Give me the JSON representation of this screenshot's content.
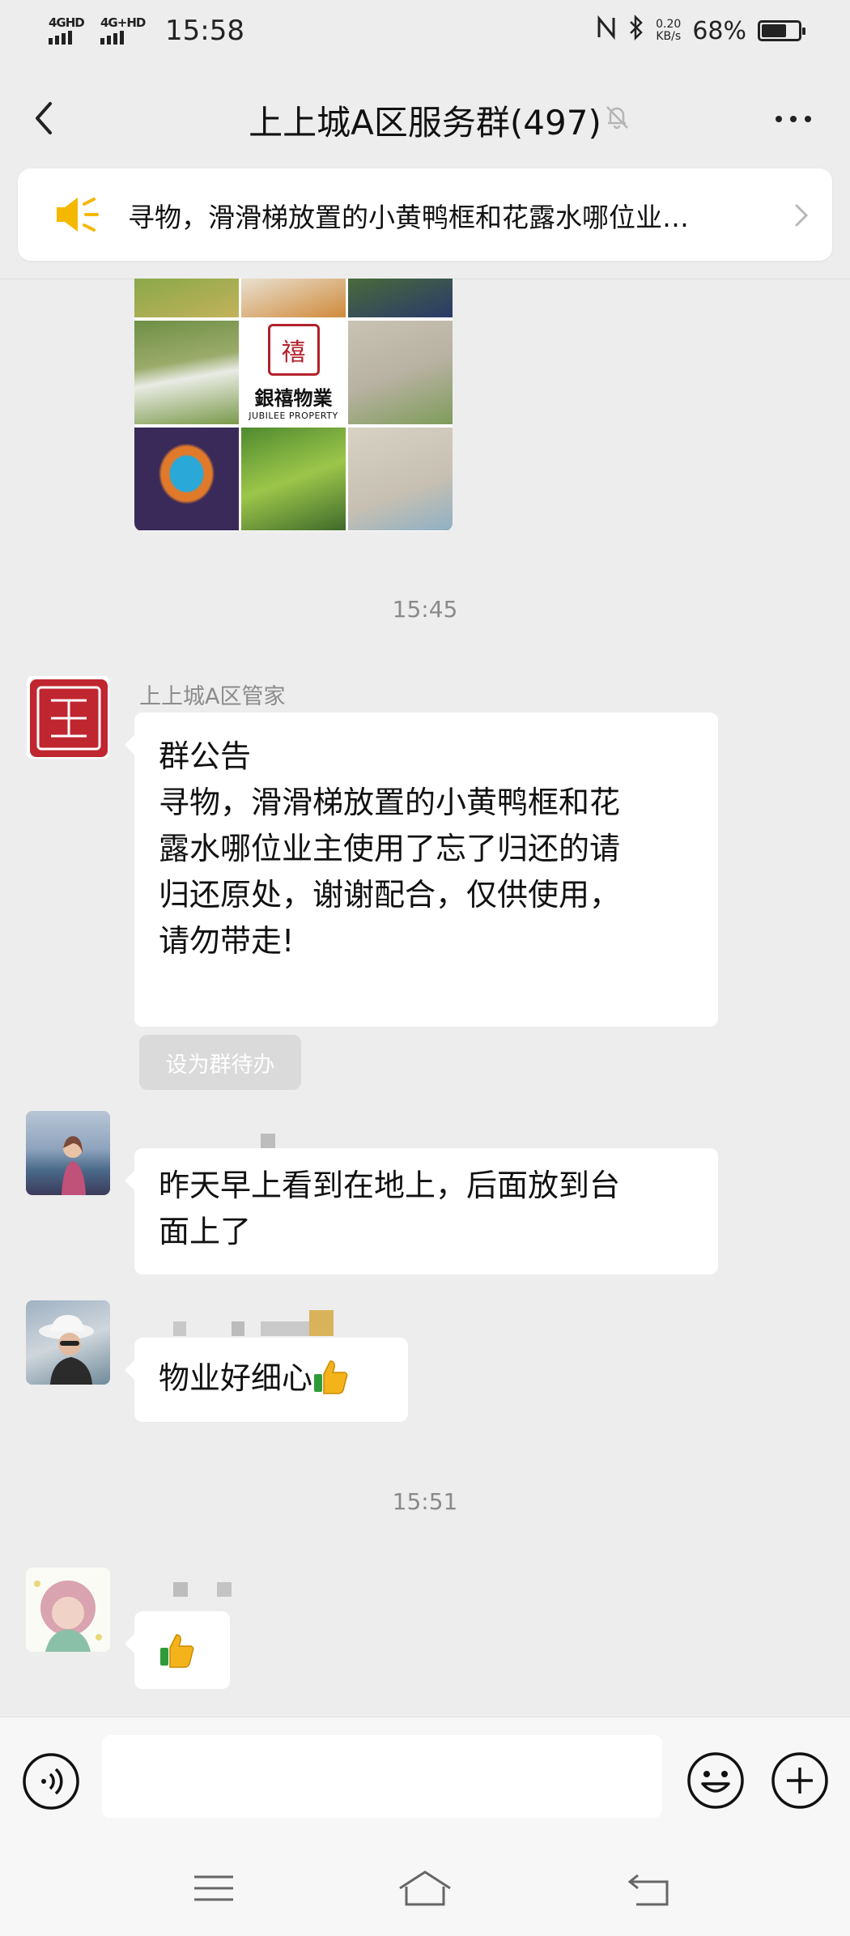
{
  "status_bar": {
    "sim1": "4GHD",
    "sim2": "4G+HD",
    "time": "15:58",
    "net_speed_value": "0.20",
    "net_speed_unit": "KB/s",
    "battery_text": "68%",
    "battery_level": 0.68
  },
  "header": {
    "title": "上上城A区服务群(497)",
    "muted_icon": "bell-off-icon",
    "back_icon": "chevron-left-icon",
    "more_icon": "more-dots-icon"
  },
  "pinned_notice": {
    "icon": "speaker-icon",
    "text": "寻物，滑滑梯放置的小黄鸭框和花露水哪位业…"
  },
  "photo_message": {
    "logo_text": "銀禧物業",
    "logo_sub": "JUBILEE PROPERTY"
  },
  "timestamps": [
    "15:45",
    "15:51"
  ],
  "messages": [
    {
      "sender": "上上城A区管家",
      "lines": [
        "群公告",
        "寻物，滑滑梯放置的小黄鸭框和花",
        "露水哪位业主使用了忘了归还的请",
        "归还原处，谢谢配合，仅供使用，",
        "请勿带走!"
      ],
      "action_label": "设为群待办"
    },
    {
      "lines": [
        "昨天早上看到在地上，后面放到台",
        "面上了"
      ]
    },
    {
      "text": "物业好细心"
    },
    {
      "text": ""
    }
  ],
  "input_bar": {
    "voice_icon": "voice-icon",
    "emoji_icon": "emoji-icon",
    "plus_icon": "plus-icon",
    "placeholder": ""
  },
  "colors": {
    "background": "#ededed",
    "bubble": "#ffffff",
    "seal_red": "#b3212b",
    "notice_yellow": "#f5b800"
  }
}
